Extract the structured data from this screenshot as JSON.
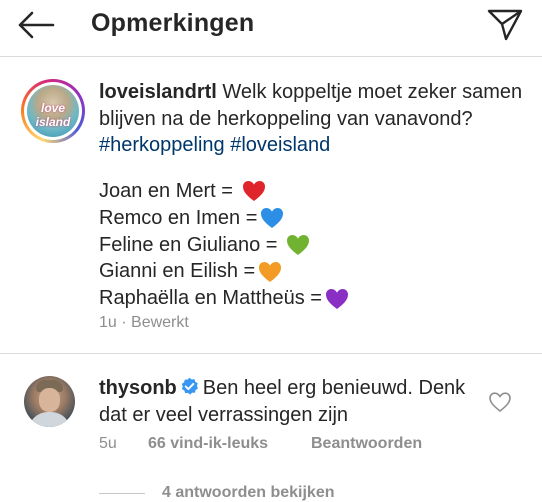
{
  "header": {
    "title": "Opmerkingen",
    "back_icon": "arrow-left-icon",
    "share_icon": "paper-plane-icon"
  },
  "post": {
    "username": "loveislandrtl",
    "avatar_text": "love island",
    "text_before": " Welk koppeltje moet zeker samen blijven na de herkoppeling van vanavond? ",
    "hashtags": [
      "#herkoppeling",
      "#loveisland"
    ],
    "couples": [
      {
        "text": "Joan en Mert = ",
        "heart": "red-heart",
        "color": "#e0242c"
      },
      {
        "text": "Remco en Imen =",
        "heart": "blue-heart",
        "color": "#2d8ee6"
      },
      {
        "text": "Feline en Giuliano = ",
        "heart": "green-heart",
        "color": "#71b330"
      },
      {
        "text": "Gianni en Eilish =",
        "heart": "orange-heart",
        "color": "#f29b25"
      },
      {
        "text": "Raphaëlla en Mattheüs =",
        "heart": "purple-heart",
        "color": "#8a2fc4"
      }
    ],
    "time": "1u",
    "separator": "·",
    "edited": "Bewerkt"
  },
  "comment": {
    "username": "thysonb",
    "verified": true,
    "text": "Ben heel erg benieuwd. Denk dat er veel verrassingen zijn",
    "time": "5u",
    "likes": "66 vind-ik-leuks",
    "reply": "Beantwoorden",
    "view_replies": "4 antwoorden bekijken"
  },
  "colors": {
    "text": "#262626",
    "muted": "#8e8e8e",
    "hashtag": "#00376b",
    "verified": "#3897f0",
    "divider": "#dbdbdb"
  }
}
